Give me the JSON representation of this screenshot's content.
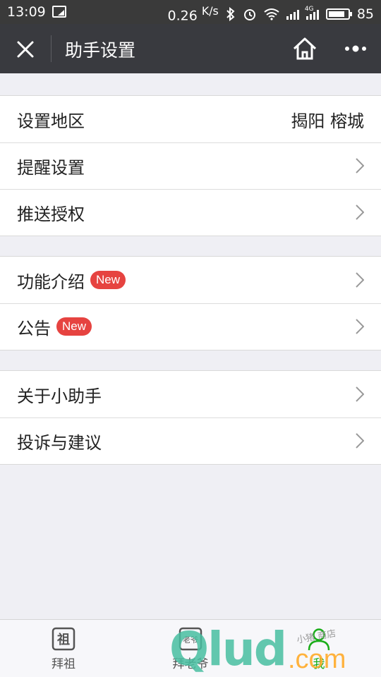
{
  "status_bar": {
    "time": "13:09",
    "speed": "0.26",
    "speed_unit": "K/s",
    "network_tag": "4G",
    "battery": "85"
  },
  "nav": {
    "title": "助手设置",
    "close_icon": "close-icon",
    "home_icon": "home-icon",
    "more_icon": "more-icon"
  },
  "groups": [
    {
      "items": [
        {
          "label": "设置地区",
          "value": "揭阳 榕城"
        },
        {
          "label": "提醒设置"
        },
        {
          "label": "推送授权"
        }
      ]
    },
    {
      "items": [
        {
          "label": "功能介绍",
          "badge": "New"
        },
        {
          "label": "公告",
          "badge": "New"
        }
      ]
    },
    {
      "items": [
        {
          "label": "关于小助手"
        },
        {
          "label": "投诉与建议"
        }
      ]
    }
  ],
  "tabbar": {
    "tabs": [
      {
        "label": "拜祖",
        "icon": "拜祖-icon",
        "icon_text": "祖"
      },
      {
        "label": "拜老爷",
        "icon": "temple-icon",
        "icon_text": "老爷"
      },
      {
        "label": "我",
        "icon": "person-icon"
      }
    ]
  },
  "watermark": {
    "text": "Qlud",
    "suffix": ".com",
    "caption": "小猪 商店"
  },
  "colors": {
    "nav_bg": "#393a3f",
    "badge": "#e64340",
    "active_tab": "#1aad19",
    "page_bg": "#efeff4"
  }
}
